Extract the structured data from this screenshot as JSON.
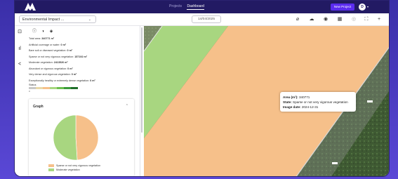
{
  "nav": {
    "projects": "Projects",
    "dashboard": "Dashboard"
  },
  "header": {
    "new_project": "New Project",
    "avatar_initial": "D"
  },
  "toolbar": {
    "project_select": "Environmental Impact ...",
    "date": "14/04/2025"
  },
  "stats": {
    "total_area": {
      "label": "Total area:",
      "value": "340771 m²"
    },
    "artificial": {
      "label": "Artificial coverage or water:",
      "value": "0 m²"
    },
    "bare_soil": {
      "label": "Bare soil or diseased vegetation:",
      "value": "0 m²"
    },
    "sparse": {
      "label": "Sparse or not very vigorous vegetation:",
      "value": "157192 m²"
    },
    "moderate": {
      "label": "Moderate vegetation:",
      "value": "2413526 m²"
    },
    "abundant": {
      "label": "Abundant or vigorous vegetation:",
      "value": "0 m²"
    },
    "very_dense": {
      "label": "Very dense and vigorous vegetation:",
      "value": "0 m²"
    },
    "exceptional": {
      "label": "Exceptionally healthy or extremely dense vegetation:",
      "value": "0 m²"
    },
    "status_label": "Status",
    "status_tick": "0"
  },
  "graph": {
    "title": "Graph",
    "legend": [
      {
        "label": "Sparse or not very vigorous vegetation",
        "color": "#f6c08a"
      },
      {
        "label": "Moderate vegetation",
        "color": "#a8d680"
      }
    ]
  },
  "chart_data": {
    "type": "pie",
    "labels": [
      "Sparse or not very vigorous vegetation",
      "Moderate vegetation"
    ],
    "values": [
      49,
      51
    ],
    "colors": [
      "#f6c08a",
      "#a8d680"
    ]
  },
  "tooltip": {
    "area_label": "Area (m²):",
    "area_value": "340771",
    "state_label": "State:",
    "state_value": "Sparse or not very vigorous vegetation",
    "date_label": "Image date:",
    "date_value": "2024-12-31"
  },
  "colors": {
    "accent": "#5b2cf0",
    "header_bg": "#221a63",
    "map_sparse": "#f6c08a",
    "map_moderate": "#a8d680"
  },
  "icons": {
    "info": "info-icon",
    "contrast": "contrast-icon",
    "layers": "layers-icon",
    "ruler": "ruler-icon",
    "cloud": "cloud-icon",
    "globe": "globe-icon",
    "grid": "grid-icon",
    "eye": "eye-icon",
    "fullscreen": "fullscreen-icon",
    "zoom_in": "zoom-in-icon",
    "zoom_out": "zoom-out-icon",
    "collapse": "chevron-up-icon"
  }
}
